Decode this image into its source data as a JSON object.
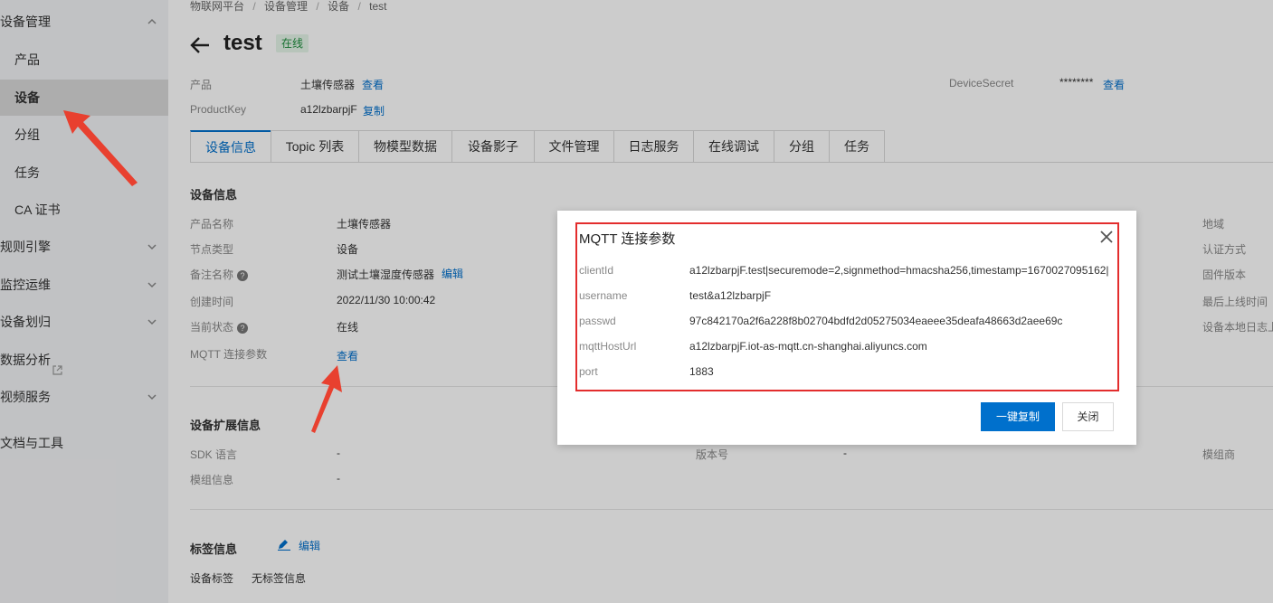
{
  "breadcrumb": [
    "物联网平台",
    "设备管理",
    "设备",
    "test"
  ],
  "page": {
    "title": "test",
    "status_badge": "在线"
  },
  "sidebar": {
    "items": [
      {
        "label": "设备管理"
      },
      {
        "label": "产品"
      },
      {
        "label": "设备"
      },
      {
        "label": "分组"
      },
      {
        "label": "任务"
      },
      {
        "label": "CA 证书"
      },
      {
        "label": "规则引擎"
      },
      {
        "label": "监控运维"
      },
      {
        "label": "设备划归"
      },
      {
        "label": "数据分析"
      },
      {
        "label": "视频服务"
      },
      {
        "label": "文档与工具"
      }
    ]
  },
  "header": {
    "product_label": "产品",
    "product_value": "土壤传感器",
    "view_link": "查看",
    "productkey_label": "ProductKey",
    "productkey_value": "a12lzbarpjF",
    "copy_link": "复制",
    "devicesecret_label": "DeviceSecret",
    "devicesecret_value": "********",
    "devicesecret_link": "查看"
  },
  "tabs": [
    "设备信息",
    "Topic 列表",
    "物模型数据",
    "设备影子",
    "文件管理",
    "日志服务",
    "在线调试",
    "分组",
    "任务"
  ],
  "device_info": {
    "section_title": "设备信息",
    "rows": [
      {
        "label": "产品名称",
        "value": "土壤传感器"
      },
      {
        "label": "节点类型",
        "value": "设备"
      },
      {
        "label": "备注名称",
        "value": "测试土壤湿度传感器",
        "link": "编辑"
      },
      {
        "label": "创建时间",
        "value": "2022/11/30 10:00:42"
      },
      {
        "label": "当前状态",
        "value": "在线"
      },
      {
        "label": "MQTT 连接参数",
        "link": "查看"
      }
    ],
    "right_labels": [
      "地域",
      "认证方式",
      "固件版本",
      "最后上线时间",
      "设备本地日志上"
    ]
  },
  "ext_info": {
    "section_title": "设备扩展信息",
    "sdk_label": "SDK 语言",
    "sdk_value": "-",
    "module_label": "模组信息",
    "module_value": "-",
    "version_label": "版本号",
    "version_value": "-",
    "vendor_label": "模组商"
  },
  "tag_info": {
    "section_title": "标签信息",
    "edit_link": "编辑",
    "tag_label": "设备标签",
    "tag_value": "无标签信息"
  },
  "modal": {
    "title": "MQTT 连接参数",
    "rows": [
      {
        "key": "clientId",
        "value": "a12lzbarpjF.test|securemode=2,signmethod=hmacsha256,timestamp=1670027095162|"
      },
      {
        "key": "username",
        "value": "test&a12lzbarpjF"
      },
      {
        "key": "passwd",
        "value": "97c842170a2f6a228f8b02704bdfd2d05275034eaeee35deafa48663d2aee69c"
      },
      {
        "key": "mqttHostUrl",
        "value": "a12lzbarpjF.iot-as-mqtt.cn-shanghai.aliyuncs.com"
      },
      {
        "key": "port",
        "value": "1883"
      }
    ],
    "copy_button": "一键复制",
    "close_button": "关闭"
  },
  "colors": {
    "accent": "#0070cc",
    "highlight_red": "#e32d2d",
    "online_green": "#1e8e3e"
  },
  "icons": [
    "back-arrow-icon",
    "chevron-up-icon",
    "chevron-down-icon",
    "external-link-icon",
    "help-icon",
    "edit-pencil-icon",
    "close-icon",
    "collapse-left-icon"
  ]
}
